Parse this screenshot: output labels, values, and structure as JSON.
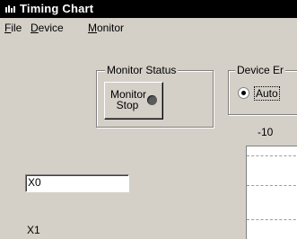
{
  "window": {
    "title": "Timing Chart"
  },
  "menu": [
    {
      "label_first": "F",
      "label_rest": "ile"
    },
    {
      "label_first": "D",
      "label_rest": "evice"
    },
    {
      "label_first": "M",
      "label_rest": "onitor"
    }
  ],
  "monitor_status": {
    "legend": "Monitor Status",
    "button_line1": "Monitor",
    "button_line2": "Stop",
    "led_color": "#5a5a5a"
  },
  "device_entry": {
    "legend": "Device Er",
    "radio_label": "Auto",
    "radio_selected": true
  },
  "chart": {
    "top_tick_label": "-10"
  },
  "channels": {
    "input_value": "X0",
    "label_x1": "X1"
  },
  "colors": {
    "face": "#d4d0c8",
    "titlebar": "#000000",
    "title_text": "#ffffff"
  }
}
